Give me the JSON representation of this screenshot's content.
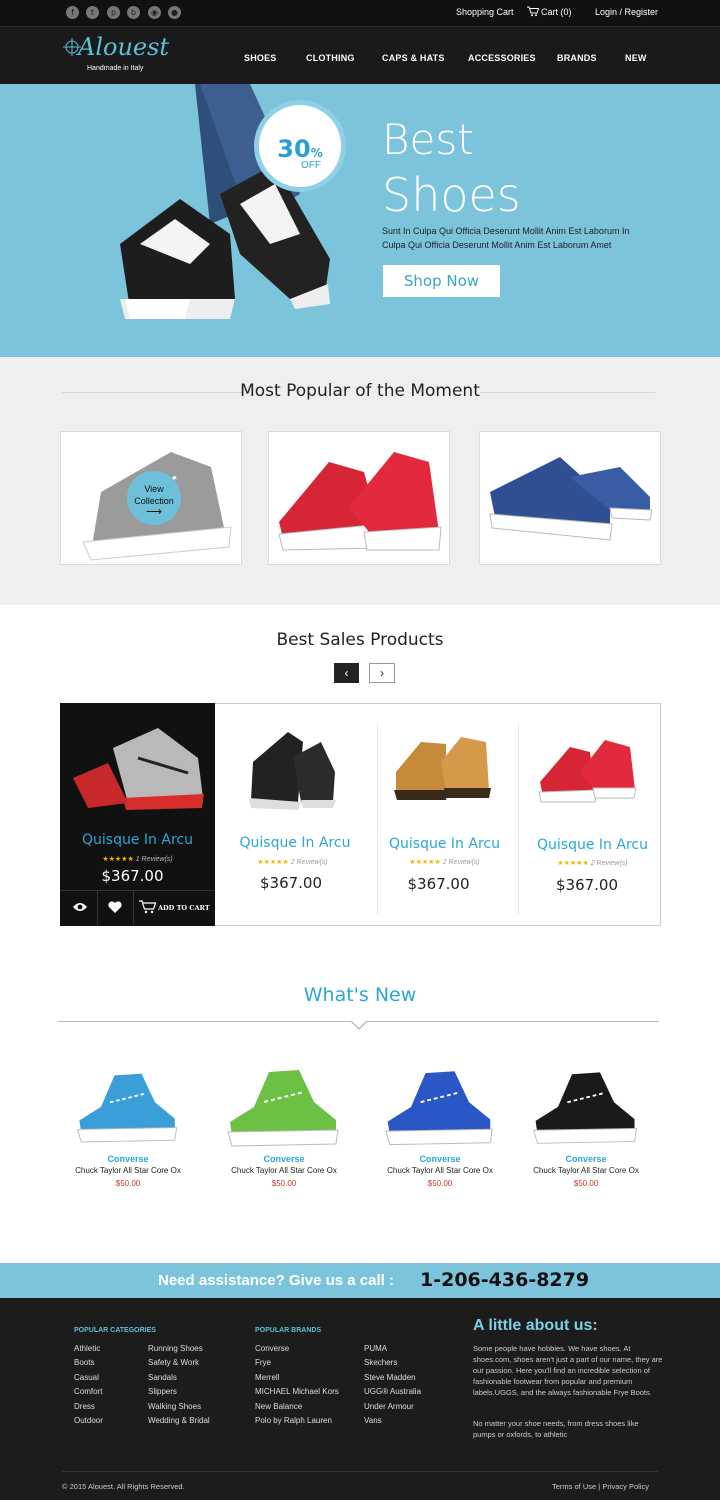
{
  "topbar": {
    "social_icons": [
      "facebook-icon",
      "twitter-icon",
      "pinterest-icon",
      "blogger-icon",
      "rss-icon",
      "dribbble-icon"
    ],
    "shopping_cart": "Shopping Cart",
    "cart": "Cart (0)",
    "login": "Login / Register"
  },
  "logo": {
    "name": "Alouest",
    "tagline": "Handmade in Italy"
  },
  "nav": [
    "SHOES",
    "CLOTHING",
    "CAPS & HATS",
    "ACCESSORIES",
    "BRANDS",
    "NEW"
  ],
  "hero": {
    "title_line1": "Best",
    "title_line2": "Shoes",
    "text": "Sunt In Culpa Qui Officia Deserunt Mollit Anim Est Laborum In Culpa Qui Officia Deserunt Mollit Anim Est Laborum Amet",
    "button": "Shop Now",
    "badge_percent": "30",
    "badge_percent_sign": "%",
    "badge_off": "OFF"
  },
  "popular": {
    "title": "Most Popular of the Moment",
    "view_collection": "View Collection"
  },
  "best_sales": {
    "title": "Best Sales Products",
    "prev": "‹",
    "next": "›",
    "add_to_cart": "ADD TO CART",
    "products": [
      {
        "name": "Quisque In Arcu",
        "reviews": "1 Review(s)",
        "price": "$367.00"
      },
      {
        "name": "Quisque In Arcu",
        "reviews": "2 Review(s)",
        "price": "$367.00"
      },
      {
        "name": "Quisque In Arcu",
        "reviews": "2 Review(s)",
        "price": "$367.00"
      },
      {
        "name": "Quisque In Arcu",
        "reviews": "2 Review(s)",
        "price": "$367.00"
      }
    ],
    "stars": "★★★★★"
  },
  "whats_new": {
    "title": "What's New",
    "items": [
      {
        "brand": "Converse",
        "model": "Chuck Taylor All Star Core Ox",
        "price": "$50.00",
        "color": "#3a9fd8"
      },
      {
        "brand": "Converse",
        "model": "Chuck Taylor All Star Core Ox",
        "price": "$50.00",
        "color": "#6cc043"
      },
      {
        "brand": "Converse",
        "model": "Chuck Taylor All Star Core Ox",
        "price": "$50.00",
        "color": "#2b56c6"
      },
      {
        "brand": "Converse",
        "model": "Chuck Taylor All Star Core Ox",
        "price": "$50.00",
        "color": "#1a1a1a"
      }
    ]
  },
  "assist": {
    "text": "Need assistance? Give us a call :",
    "phone": "1-206-436-8279"
  },
  "footer": {
    "categories_title": "POPULAR CATEGORIES",
    "categories_col1": [
      "Athletic",
      "Boots",
      "Casual",
      "Comfort",
      "Dress",
      "Outdoor"
    ],
    "categories_col2": [
      "Running Shoes",
      "Safety & Work",
      "Sandals",
      "Slippers",
      "Walking Shoes",
      "Wedding & Bridal"
    ],
    "brands_title": "POPULAR BRANDS",
    "brands_col1": [
      "Converse",
      "Frye",
      "Merrell",
      "MICHAEL Michael Kors",
      "New Balance",
      "Polo by Ralph Lauren"
    ],
    "brands_col2": [
      "PUMA",
      "Skechers",
      "Steve Madden",
      "UGG® Australia",
      "Under Armour",
      "Vans"
    ],
    "about_title": "A little about us:",
    "about_p1": "Some people have hobbies. We have shoes. At shoes.com, shoes aren't just a part of our name, they are our passion. Here you'll find an incredible selection of fashionable footwear from popular and premium labels.UGGS, and the always fashionable Frye Boots.",
    "about_p2": "No matter your shoe needs, from dress shoes like pumps or oxfords, to athletic",
    "copyright": "© 2015 Alouest. All Rights Reserved.",
    "terms": "Terms of Use",
    "privacy": "Privacy Policy",
    "sep": "|"
  }
}
